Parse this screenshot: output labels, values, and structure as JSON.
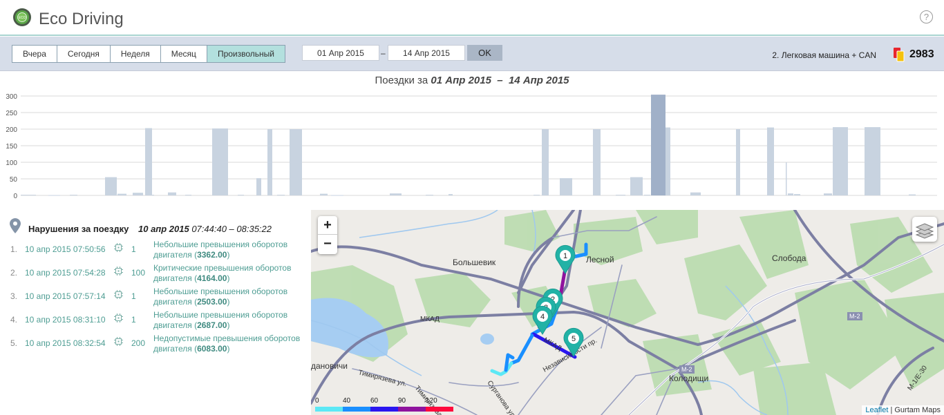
{
  "header": {
    "title": "Eco Driving",
    "help_icon": "?"
  },
  "toolbar": {
    "periods": [
      {
        "label": "Вчера"
      },
      {
        "label": "Сегодня"
      },
      {
        "label": "Неделя"
      },
      {
        "label": "Месяц"
      },
      {
        "label": "Произвольный",
        "active": true
      }
    ],
    "date_from": "01 Апр 2015",
    "separator": "–",
    "date_to": "14 Апр 2015",
    "ok_label": "OK",
    "unit": "2. Легковая машина + CAN",
    "score": "2983"
  },
  "chart_title": {
    "prefix": "Поездки за",
    "range": "01 Апр 2015  –  14 Апр 2015"
  },
  "chart_data": {
    "type": "bar",
    "title": "Поездки за 01 Апр 2015 – 14 Апр 2015",
    "ylim": [
      0,
      300
    ],
    "yticks": [
      0,
      50,
      100,
      150,
      200,
      250,
      300
    ],
    "grid": true,
    "values": [
      2,
      1,
      2,
      55,
      5,
      8,
      203,
      2,
      9,
      2,
      202,
      2,
      52,
      200,
      2,
      200,
      5,
      1,
      6,
      2,
      4,
      2,
      200,
      52,
      200,
      2,
      55,
      2,
      304,
      205,
      9,
      200,
      205,
      100,
      6,
      4,
      6,
      206,
      206,
      3
    ],
    "selected_index": 28,
    "colors": {
      "bar": "#c8d3e0",
      "selected": "#a0b0c8"
    }
  },
  "violations": {
    "title": "Нарушения за поездку",
    "date": "10 апр 2015",
    "time_range": " 07:44:40 – 08:35:22",
    "items": [
      {
        "n": "1.",
        "time": "10 апр 2015 07:50:56",
        "count": "1",
        "desc": "Небольшие превышения оборотов двигателя (",
        "value": "3362.00",
        "close": ")"
      },
      {
        "n": "2.",
        "time": "10 апр 2015 07:54:28",
        "count": "100",
        "desc": "Критические превышения оборотов двигателя (",
        "value": "4164.00",
        "close": ")"
      },
      {
        "n": "3.",
        "time": "10 апр 2015 07:57:14",
        "count": "1",
        "desc": "Небольшие превышения оборотов двигателя (",
        "value": "2503.00",
        "close": ")"
      },
      {
        "n": "4.",
        "time": "10 апр 2015 08:31:10",
        "count": "1",
        "desc": "Небольшие превышения оборотов двигателя (",
        "value": "2687.00",
        "close": ")"
      },
      {
        "n": "5.",
        "time": "10 апр 2015 08:32:54",
        "count": "200",
        "desc": "Недопустимые превышения оборотов двигателя (",
        "value": "6083.00",
        "close": ")"
      }
    ]
  },
  "map": {
    "zoom_in": "+",
    "zoom_out": "−",
    "places": [
      "Большевик",
      "Лесной",
      "Слобода",
      "Колодищи",
      "дановичи"
    ],
    "roads": [
      "МКАД",
      "МКАД",
      "М-2",
      "М-2",
      "М-1/Е-30",
      "Тимирязева ул.",
      "Тимирязева",
      "Сурганова ул.",
      "Независимости пр."
    ],
    "markers": [
      "1",
      "2",
      "3",
      "4",
      "5"
    ],
    "speed_legend": [
      {
        "label": "0",
        "color": "#5ce8f5"
      },
      {
        "label": "40",
        "color": "#1a8fff"
      },
      {
        "label": "60",
        "color": "#2a16f0"
      },
      {
        "label": "90",
        "color": "#8f139e"
      },
      {
        "label": "120",
        "color": "#ff0a3c"
      }
    ],
    "attribution_link": "Leaflet",
    "attribution_text": " | Gurtam Maps"
  }
}
